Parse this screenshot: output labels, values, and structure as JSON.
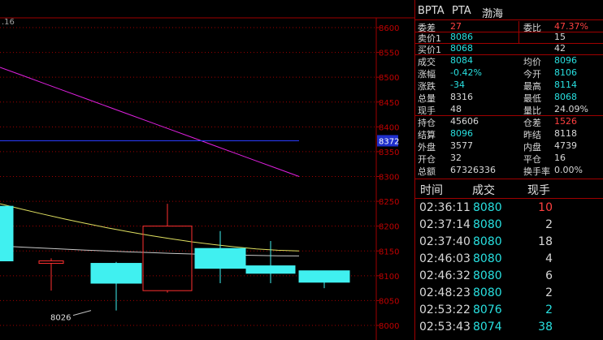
{
  "chart": {
    "corner_label": ".16",
    "price_axis": [
      "8600",
      "8550",
      "8500",
      "8450",
      "8400",
      "8350",
      "8300",
      "8250",
      "8200",
      "8150",
      "8100",
      "8050",
      "8000"
    ],
    "price_min": 8000,
    "price_max": 8600,
    "current_price_marker": "8372",
    "low_annotation": "8026",
    "candles": [
      {
        "open": 8240,
        "close": 8130,
        "high": 8240,
        "low": 8130,
        "color": "cyan"
      },
      {
        "open": 8130,
        "close": 8125,
        "high": 8135,
        "low": 8070,
        "color": "red"
      },
      {
        "open": 8125,
        "close": 8085,
        "high": 8128,
        "low": 8030,
        "color": "cyan"
      },
      {
        "open": 8070,
        "close": 8200,
        "high": 8245,
        "low": 8066,
        "color": "red"
      },
      {
        "open": 8155,
        "close": 8115,
        "high": 8190,
        "low": 8085,
        "color": "cyan"
      },
      {
        "open": 8120,
        "close": 8105,
        "high": 8170,
        "low": 8085,
        "color": "cyan"
      },
      {
        "open": 8110,
        "close": 8087,
        "high": 8110,
        "low": 8075,
        "color": "cyan"
      }
    ],
    "ma_magenta": [
      8520,
      8300
    ],
    "ma_yellow": [
      8245,
      8150
    ],
    "ma_gray": [
      8160,
      8140
    ]
  },
  "panel": {
    "header": {
      "contract": "BPTA",
      "name": "PTA",
      "exchange": "渤海"
    },
    "weibi": {
      "label": "委差",
      "value": "27",
      "label2": "委比",
      "value2": "47.37%"
    },
    "sell1": {
      "label": "卖价1",
      "price": "8086",
      "qty": "15"
    },
    "buy1": {
      "label": "买价1",
      "price": "8068",
      "qty": "42"
    },
    "stats": [
      {
        "l": "成交",
        "v": "8084",
        "vc": "cy",
        "l2": "均价",
        "v2": "8096",
        "v2c": "cy"
      },
      {
        "l": "涨幅",
        "v": "-0.42%",
        "vc": "cy",
        "l2": "今开",
        "v2": "8106",
        "v2c": "cy"
      },
      {
        "l": "涨跌",
        "v": "-34",
        "vc": "cy",
        "l2": "最高",
        "v2": "8114",
        "v2c": "cy"
      },
      {
        "l": "总量",
        "v": "8316",
        "vc": "cw",
        "l2": "最低",
        "v2": "8068",
        "v2c": "cy"
      },
      {
        "l": "现手",
        "v": "48",
        "vc": "cw",
        "l2": "量比",
        "v2": "24.09%",
        "v2c": "cw"
      }
    ],
    "stats2": [
      {
        "l": "持仓",
        "v": "45606",
        "vc": "cw",
        "l2": "仓差",
        "v2": "1526",
        "v2c": "cr"
      },
      {
        "l": "结算",
        "v": "8096",
        "vc": "cy",
        "l2": "昨结",
        "v2": "8118",
        "v2c": "cw"
      },
      {
        "l": "外盘",
        "v": "3577",
        "vc": "cw",
        "l2": "内盘",
        "v2": "4739",
        "v2c": "cw"
      },
      {
        "l": "开仓",
        "v": "32",
        "vc": "cw",
        "l2": "平仓",
        "v2": "16",
        "v2c": "cw"
      },
      {
        "l": "总额",
        "v": "67326336",
        "vc": "cw",
        "l2": "换手率",
        "v2": "0.00%",
        "v2c": "cw"
      }
    ],
    "trades_header": {
      "time": "时间",
      "price": "成交",
      "qty": "现手"
    },
    "trades": [
      {
        "time": "02:36:11",
        "price": "8080",
        "qty": "10",
        "qc": "cr"
      },
      {
        "time": "02:37:14",
        "price": "8080",
        "qty": "2",
        "qc": "cw"
      },
      {
        "time": "02:37:40",
        "price": "8080",
        "qty": "18",
        "qc": "cw"
      },
      {
        "time": "02:46:03",
        "price": "8080",
        "qty": "4",
        "qc": "cw"
      },
      {
        "time": "02:46:32",
        "price": "8080",
        "qty": "6",
        "qc": "cw"
      },
      {
        "time": "02:48:23",
        "price": "8080",
        "qty": "2",
        "qc": "cw"
      },
      {
        "time": "02:53:22",
        "price": "8076",
        "qty": "2",
        "qc": "cy"
      },
      {
        "time": "02:53:43",
        "price": "8074",
        "qty": "38",
        "qc": "cy"
      }
    ]
  }
}
